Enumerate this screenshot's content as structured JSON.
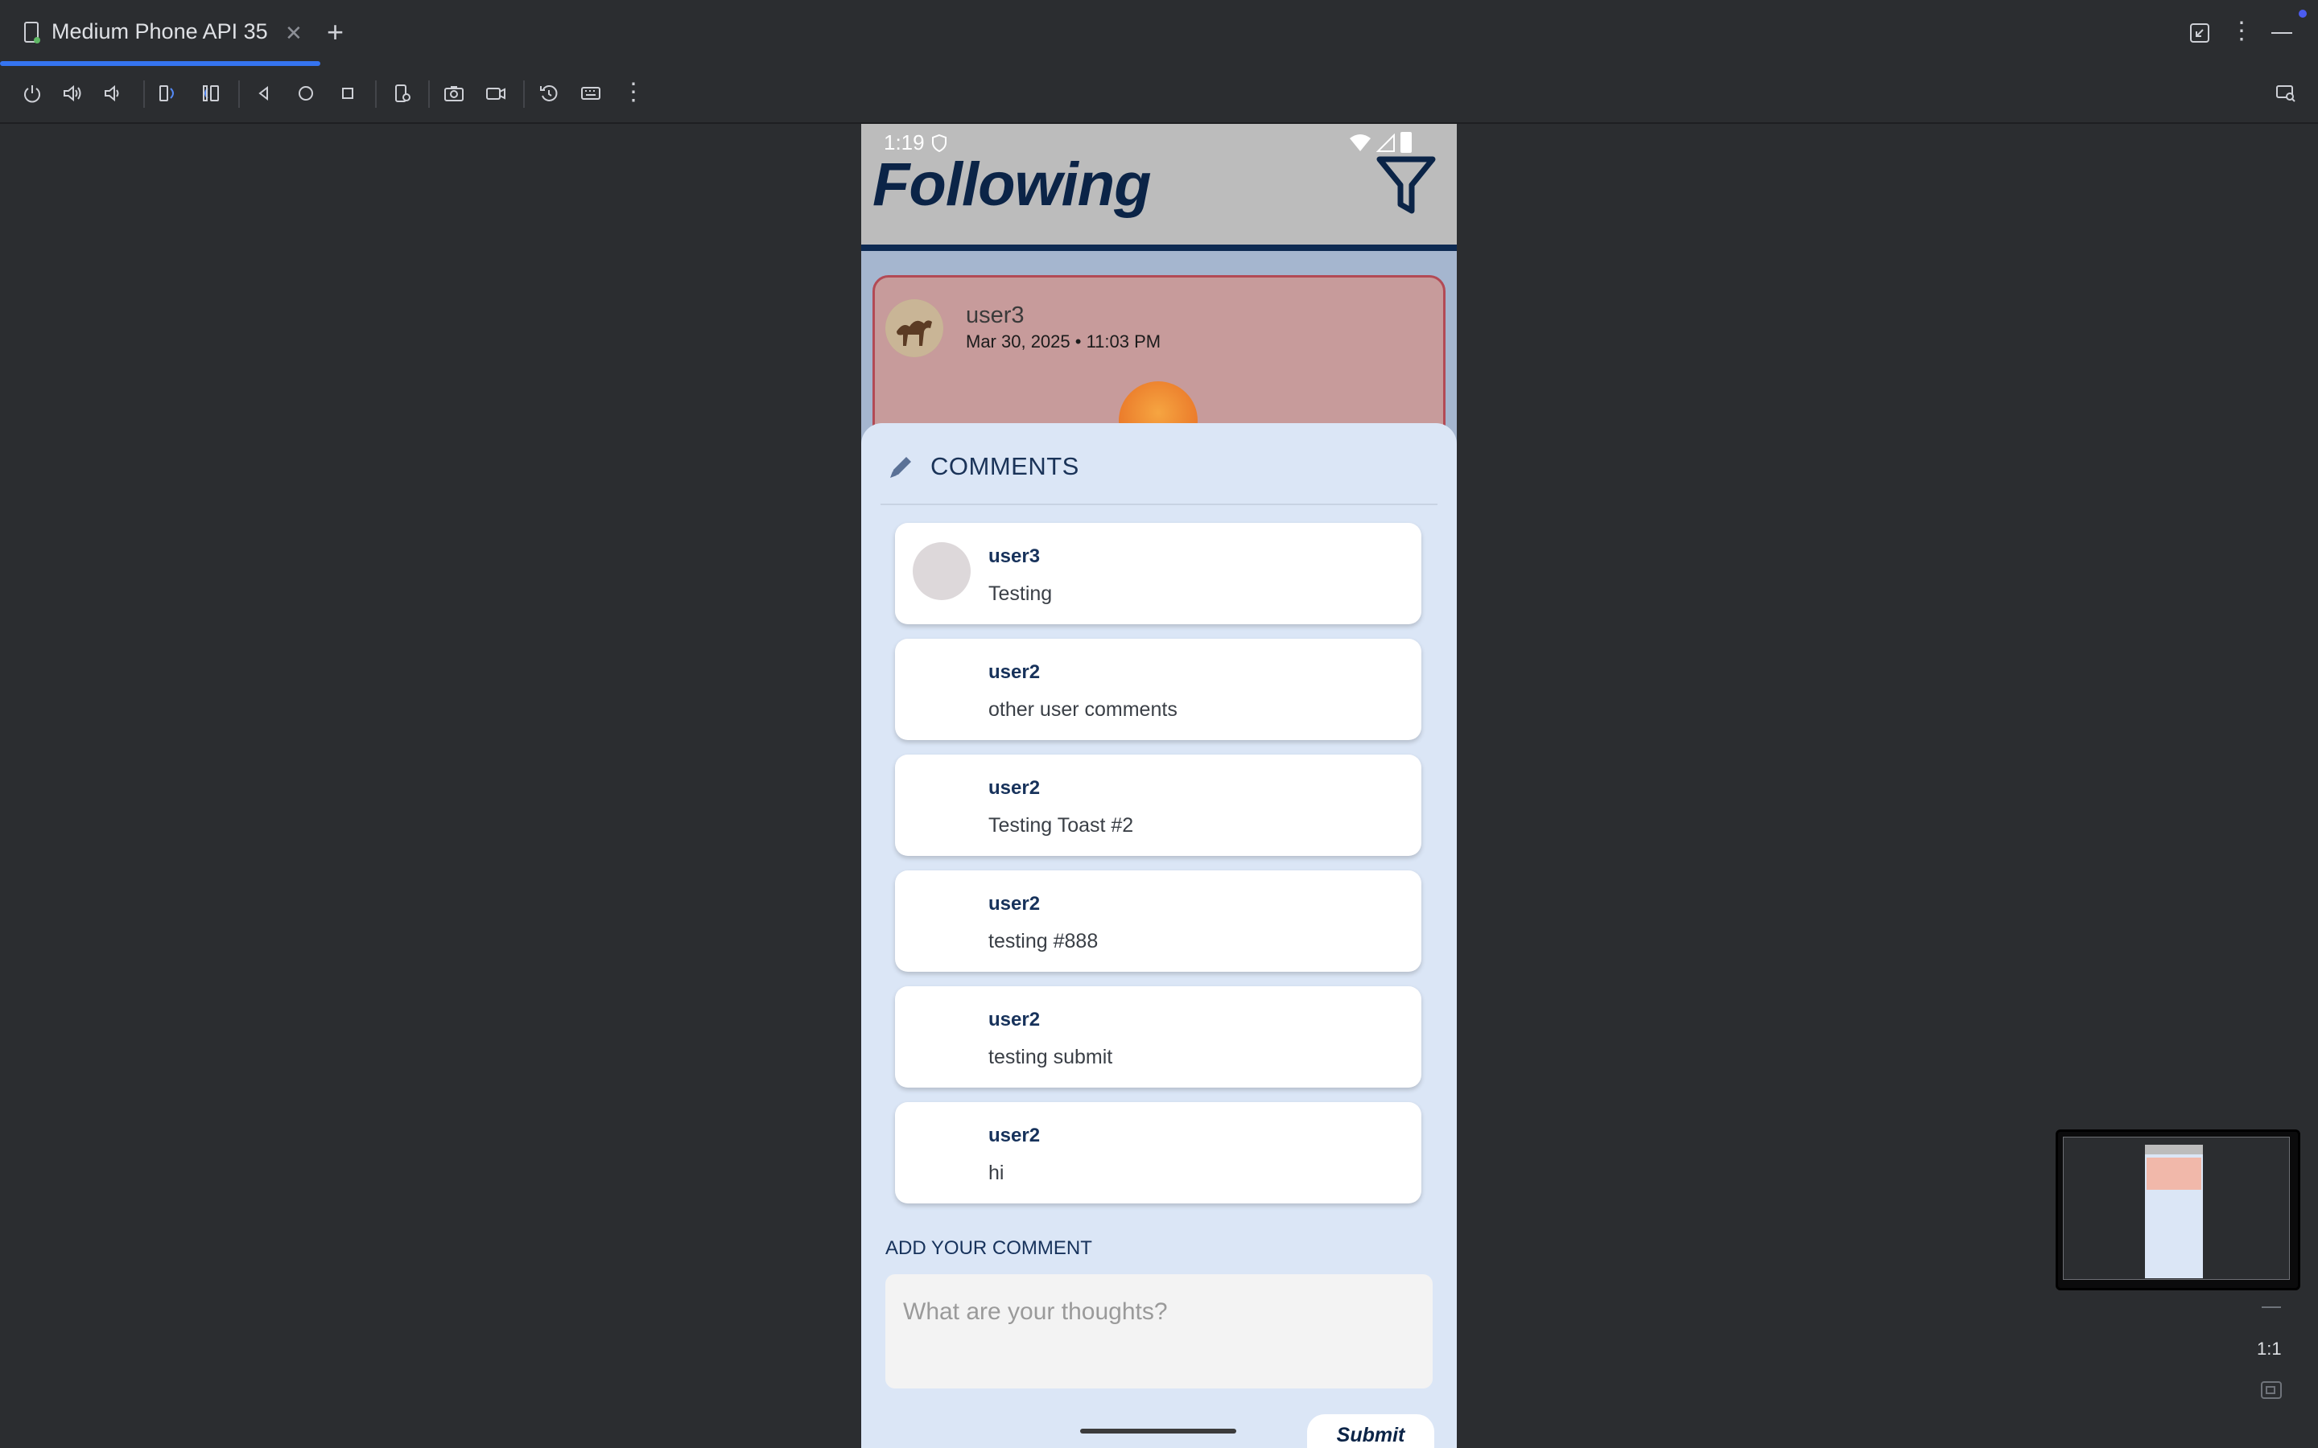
{
  "tab": {
    "title": "Medium Phone API 35"
  },
  "colors": {
    "accent": "#3574f0",
    "app_navy": "#0b2447",
    "sheet_bg": "#dbe6f6",
    "post_card_border": "#b34a55"
  },
  "phone": {
    "status_time": "1:19",
    "page_title": "Following",
    "post": {
      "user": "user3",
      "date": "Mar 30, 2025 • 11:03 PM"
    },
    "comments_title": "COMMENTS",
    "comments": [
      {
        "user": "user3",
        "text": "Testing"
      },
      {
        "user": "user2",
        "text": "other user comments"
      },
      {
        "user": "user2",
        "text": "Testing Toast #2"
      },
      {
        "user": "user2",
        "text": "testing #888"
      },
      {
        "user": "user2",
        "text": "testing submit"
      },
      {
        "user": "user2",
        "text": "hi"
      }
    ],
    "add_comment_label": "ADD YOUR COMMENT",
    "input_placeholder": "What are your thoughts?",
    "submit_label": "Submit"
  },
  "zoom": {
    "ratio_label": "1:1"
  }
}
